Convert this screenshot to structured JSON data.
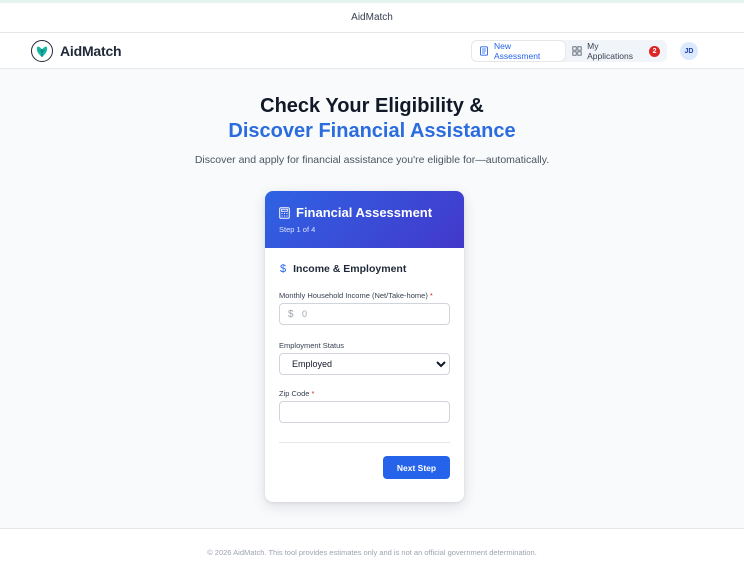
{
  "window": {
    "title": "AidMatch"
  },
  "navbar": {
    "brand": "AidMatch",
    "tabs": [
      {
        "label": "New Assessment",
        "icon": "document-icon",
        "active": true
      },
      {
        "label": "My Applications",
        "icon": "grid-icon",
        "badge": "2",
        "active": false
      }
    ],
    "avatar": "JD"
  },
  "hero": {
    "line1": "Check Your Eligibility &",
    "line2": "Discover Financial Assistance",
    "subtitle": "Discover and apply for financial assistance you're eligible for—automatically."
  },
  "card": {
    "title": "Financial Assessment",
    "step": "Step 1 of 4",
    "section": {
      "icon": "dollar-icon",
      "symbol": "$",
      "title": "Income & Employment"
    },
    "fields": {
      "income": {
        "label": "Monthly Household Income (Net/Take-home)",
        "required": "*",
        "currency": "$",
        "placeholder": "0",
        "value": ""
      },
      "employment": {
        "label": "Employment Status",
        "selected": "Employed"
      },
      "zip": {
        "label": "Zip Code",
        "required": "*",
        "value": ""
      }
    },
    "next_label": "Next Step"
  },
  "footer": {
    "text": "© 2026 AidMatch. This tool provides estimates only and is not an official government determination."
  },
  "colors": {
    "accent": "#2563eb",
    "header_gradient_start": "#2f63e4",
    "header_gradient_end": "#4338ca",
    "badge": "#dc2626",
    "brand_logo": "#14b8a6"
  }
}
